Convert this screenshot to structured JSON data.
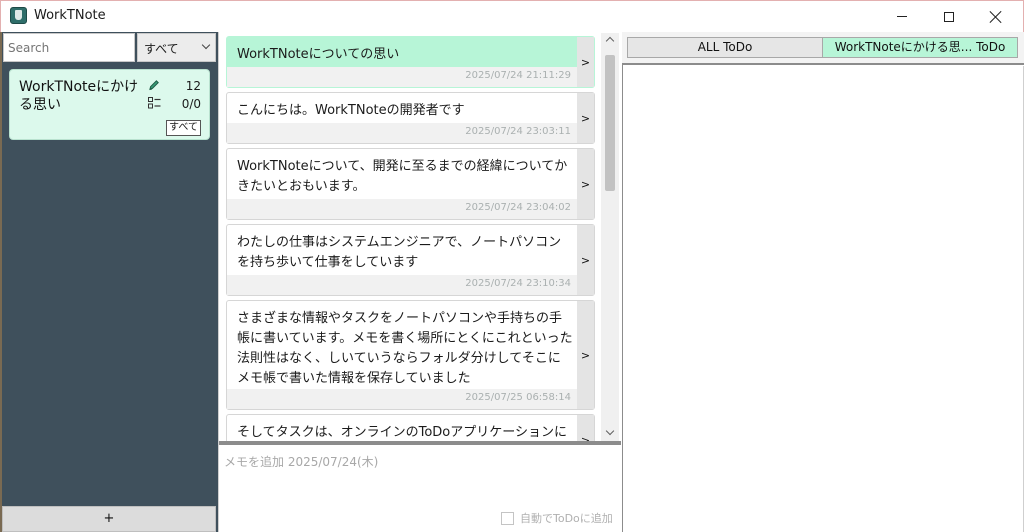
{
  "app": {
    "title": "WorkTNote",
    "window_controls": [
      "minimize",
      "maximize",
      "close"
    ]
  },
  "sidebar": {
    "search_placeholder": "Search",
    "filter_selected": "すべて",
    "notes": [
      {
        "title": "WorkTNoteにかける思い",
        "memo_count": "12",
        "todo_progress": "0/0",
        "button_label": "すべて",
        "color": "#dcf9ec"
      }
    ],
    "add_label": "+"
  },
  "memos": [
    {
      "text": "WorkTNoteについての思い",
      "date": "2025/07/24 21:11:29",
      "highlight": true
    },
    {
      "text": "こんにちは。WorkTNoteの開発者です",
      "date": "2025/07/24 23:03:11"
    },
    {
      "text": "WorkTNoteについて、開発に至るまでの経緯についてかきたいとおもいます。",
      "date": "2025/07/24 23:04:02"
    },
    {
      "text": "わたしの仕事はシステムエンジニアで、ノートパソコンを持ち歩いて仕事をしています",
      "date": "2025/07/24 23:10:34"
    },
    {
      "text": "さまざまな情報やタスクをノートパソコンや手持ちの手帳に書いています。メモを書く場所にとくにこれといった法則性はなく、しいていうならフォルダ分けしてそこにメモ帳で書いた情報を保存していました",
      "date": "2025/07/25 06:58:14"
    },
    {
      "text": "そしてタスクは、オンラインのToDoアプリケーションに追加し、ど",
      "date": ""
    }
  ],
  "memo_arrow": ">",
  "memo_input": {
    "placeholder": "メモを追加 2025/07/24(木)",
    "auto_todo_label": "自動でToDoに追加",
    "auto_todo_checked": false
  },
  "todo_tabs": [
    {
      "label": "ALL ToDo",
      "active": false
    },
    {
      "label": "WorkTNoteにかける思... ToDo",
      "active": true
    }
  ],
  "colors": {
    "sidebar_bg": "#3f505c",
    "highlight": "#b7f5d7",
    "note_card": "#dcf9ec"
  }
}
